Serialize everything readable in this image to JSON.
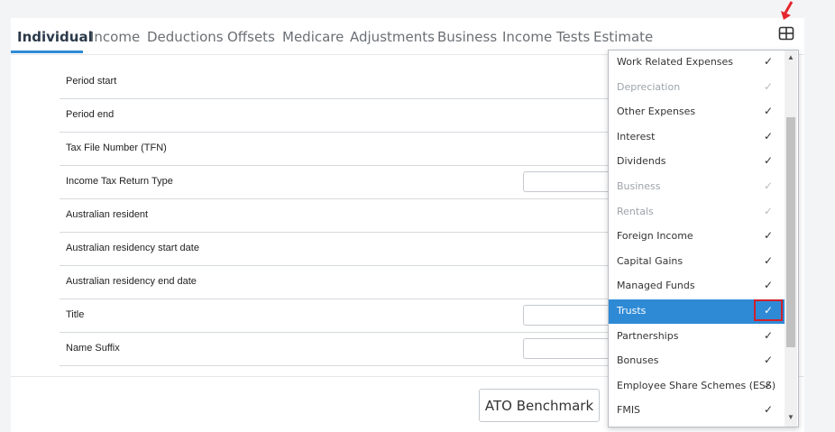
{
  "tabs": [
    {
      "label": "Individual"
    },
    {
      "label": "Income"
    },
    {
      "label": "Deductions"
    },
    {
      "label": "Offsets"
    },
    {
      "label": "Medicare"
    },
    {
      "label": "Adjustments"
    },
    {
      "label": "Business"
    },
    {
      "label": "Income Tests"
    },
    {
      "label": "Estimate"
    }
  ],
  "form": {
    "rows": [
      {
        "label": "Period start"
      },
      {
        "label": "Period end"
      },
      {
        "label": "Tax File Number (TFN)"
      },
      {
        "label": "Income Tax Return Type"
      },
      {
        "label": "Australian resident"
      },
      {
        "label": "Australian residency start date"
      },
      {
        "label": "Australian residency end date"
      },
      {
        "label": "Title"
      },
      {
        "label": "Name Suffix"
      }
    ]
  },
  "footer": {
    "ato_benchmark_label": "ATO Benchmark"
  },
  "dropdown": {
    "items": [
      {
        "label": "Work Related Expenses",
        "checked": true,
        "disabled": false,
        "selected": false
      },
      {
        "label": "Depreciation",
        "checked": true,
        "disabled": true,
        "selected": false
      },
      {
        "label": "Other Expenses",
        "checked": true,
        "disabled": false,
        "selected": false
      },
      {
        "label": "Interest",
        "checked": true,
        "disabled": false,
        "selected": false
      },
      {
        "label": "Dividends",
        "checked": true,
        "disabled": false,
        "selected": false
      },
      {
        "label": "Business",
        "checked": true,
        "disabled": true,
        "selected": false
      },
      {
        "label": "Rentals",
        "checked": true,
        "disabled": true,
        "selected": false
      },
      {
        "label": "Foreign Income",
        "checked": true,
        "disabled": false,
        "selected": false
      },
      {
        "label": "Capital Gains",
        "checked": true,
        "disabled": false,
        "selected": false
      },
      {
        "label": "Managed Funds",
        "checked": true,
        "disabled": false,
        "selected": false
      },
      {
        "label": "Trusts",
        "checked": true,
        "disabled": false,
        "selected": true
      },
      {
        "label": "Partnerships",
        "checked": true,
        "disabled": false,
        "selected": false
      },
      {
        "label": "Bonuses",
        "checked": true,
        "disabled": false,
        "selected": false
      },
      {
        "label": "Employee Share Schemes (ESS)",
        "checked": true,
        "disabled": false,
        "selected": false
      },
      {
        "label": "FMIS",
        "checked": true,
        "disabled": false,
        "selected": false
      }
    ]
  },
  "colors": {
    "accent": "#2f8ad6",
    "highlight": "#d0202a"
  },
  "icons": {
    "grid": "grid-icon",
    "check": "check-icon",
    "arrow": "arrow-icon"
  }
}
